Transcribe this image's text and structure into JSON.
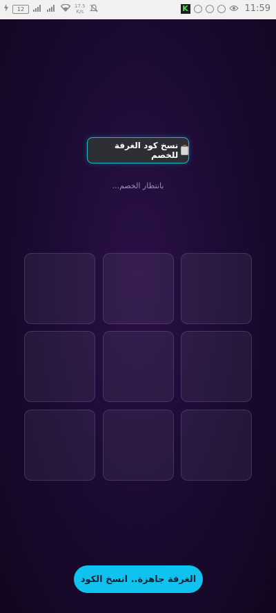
{
  "status_bar": {
    "battery_level": "12",
    "net_speed_value": "17.5",
    "net_speed_unit": "K/s",
    "time": "11:59",
    "app_badge_letter": "K",
    "icons": [
      "battery-icon",
      "signal-icon",
      "signal-icon",
      "wifi-icon",
      "mute-icon",
      "app-k-icon",
      "settings-circle-icon",
      "whatsapp-icon",
      "sim-icon",
      "eye-icon"
    ]
  },
  "copy_button": {
    "icon": "clipboard-icon",
    "label": "نسخ كود الغرفة للخصم"
  },
  "waiting_text": "بانتظار الخصم...",
  "board": {
    "cells": [
      "",
      "",
      "",
      "",
      "",
      "",
      "",
      "",
      ""
    ]
  },
  "ready_button": {
    "label": "الغرفة جاهزة.. انسخ الكود"
  },
  "colors": {
    "background": "#1a0a30",
    "accent": "#10c3ef",
    "button_dark": "#2e2f35"
  }
}
